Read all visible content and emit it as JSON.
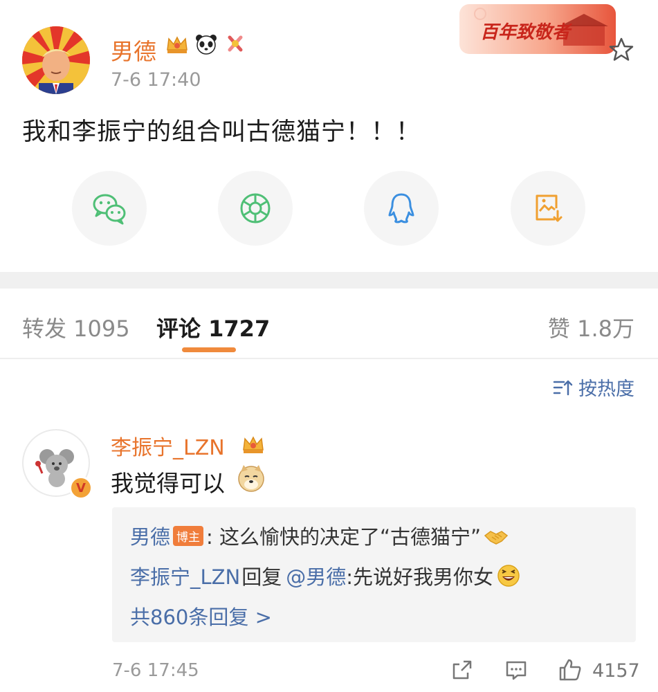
{
  "post": {
    "username": "男德",
    "time": "7-6 17:40",
    "banner": "百年致敬者",
    "text": "我和李振宁的组合叫古德猫宁！！！"
  },
  "share": [
    {
      "icon": "wechat-icon",
      "color": "#4fbf76"
    },
    {
      "icon": "moments-icon",
      "color": "#4fbf76"
    },
    {
      "icon": "qq-icon",
      "color": "#3b8fe0"
    },
    {
      "icon": "save-image-icon",
      "color": "#f0a030"
    }
  ],
  "tabs": {
    "repost": "转发 1095",
    "comment": "评论 1727",
    "like": "赞 1.8万"
  },
  "sort": {
    "label": "按热度"
  },
  "comment": {
    "username": "李振宁_LZN",
    "text": "我觉得可以",
    "verified": "V",
    "replies": {
      "r1_user": "男德",
      "r1_tag": "博主",
      "r1_text": ": 这么愉快的决定了“古德猫宁”",
      "r2_user": "李振宁_LZN",
      "r2_mid": "回复",
      "r2_at": "@男德",
      "r2_text": ":先说好我男你女",
      "more": "共860条回复 >"
    },
    "time": "7-6 17:45",
    "likes": "4157"
  },
  "colors": {
    "username": "#e8742c",
    "link": "#4a6ea8",
    "accent_underline": "#f08a3c"
  }
}
